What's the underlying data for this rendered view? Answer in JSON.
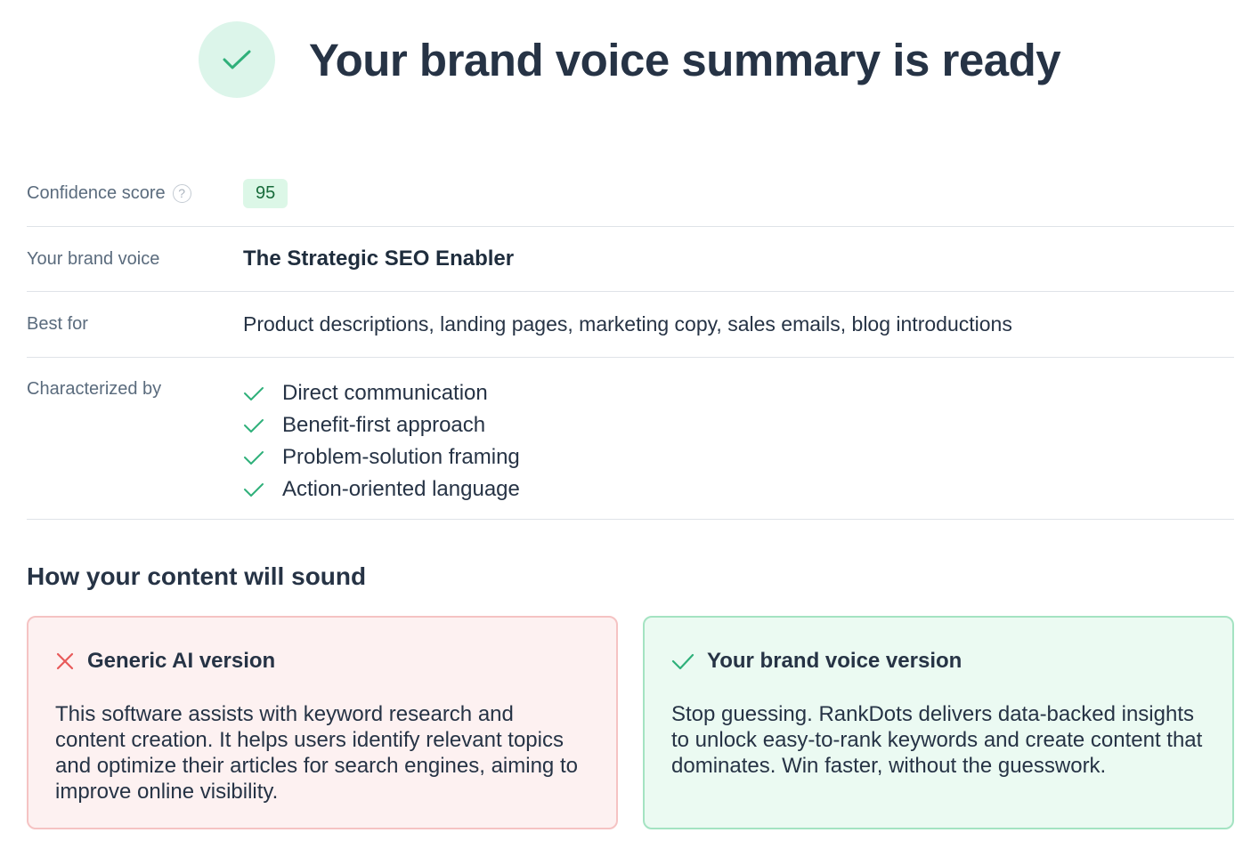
{
  "header": {
    "title": "Your brand voice summary is ready",
    "icon": "check-icon",
    "accent_color": "#2fb07a"
  },
  "summary": {
    "confidence": {
      "label": "Confidence score",
      "help_icon": "question-icon",
      "value": "95"
    },
    "voice": {
      "label": "Your brand voice",
      "value": "The Strategic SEO Enabler"
    },
    "best_for": {
      "label": "Best for",
      "value": "Product descriptions, landing pages, marketing copy, sales emails, blog introductions"
    },
    "traits": {
      "label": "Characterized by",
      "items": [
        "Direct communication",
        "Benefit-first approach",
        "Problem-solution framing",
        "Action-oriented language"
      ]
    }
  },
  "comparison": {
    "title": "How your content will sound",
    "generic": {
      "title": "Generic AI version",
      "icon": "x-icon",
      "color": "#e85a5a",
      "body": "This software assists with keyword research and content creation. It helps users identify relevant topics and optimize their articles for search engines, aiming to improve online visibility."
    },
    "brand": {
      "title": "Your brand voice version",
      "icon": "check-icon",
      "color": "#2fb07a",
      "body": "Stop guessing. RankDots delivers data-backed insights to unlock easy-to-rank keywords and create content that dominates. Win faster, without the guesswork."
    }
  }
}
